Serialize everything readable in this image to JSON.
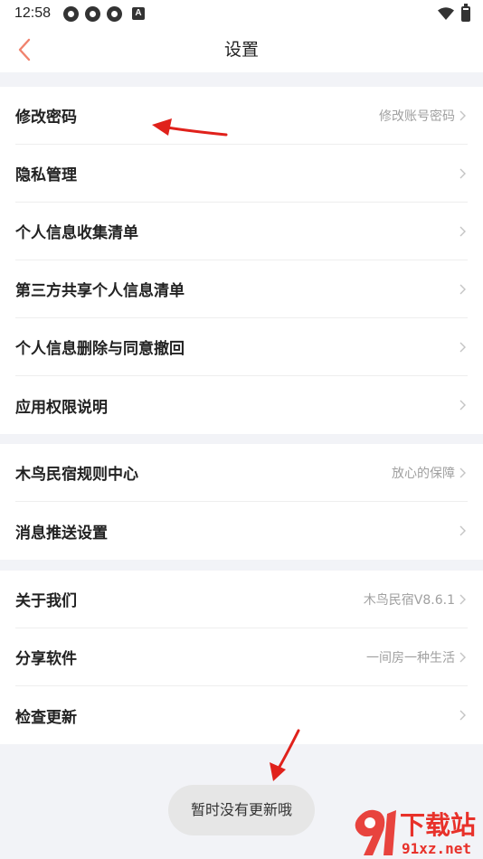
{
  "status_bar": {
    "time": "12:58",
    "icons": [
      "gear-icon",
      "gear-icon",
      "gear-icon",
      "a-badge-icon"
    ],
    "badge_letter": "A"
  },
  "nav": {
    "title": "设置",
    "back_icon": "chevron-left-icon",
    "accent_color": "#f0826d"
  },
  "groups": [
    {
      "items": [
        {
          "label": "修改密码",
          "value": "修改账号密码"
        },
        {
          "label": "隐私管理",
          "value": ""
        },
        {
          "label": "个人信息收集清单",
          "value": ""
        },
        {
          "label": "第三方共享个人信息清单",
          "value": ""
        },
        {
          "label": "个人信息删除与同意撤回",
          "value": ""
        },
        {
          "label": "应用权限说明",
          "value": ""
        }
      ]
    },
    {
      "items": [
        {
          "label": "木鸟民宿规则中心",
          "value": "放心的保障"
        },
        {
          "label": "消息推送设置",
          "value": ""
        }
      ]
    },
    {
      "items": [
        {
          "label": "关于我们",
          "value": "木鸟民宿V8.6.1"
        },
        {
          "label": "分享软件",
          "value": "一间房一种生活"
        },
        {
          "label": "检查更新",
          "value": ""
        }
      ]
    }
  ],
  "toast": {
    "message": "暂时没有更新哦"
  },
  "watermark": {
    "brand_text": "下载站",
    "url_text": "91xz.net",
    "color": "#e8312a"
  },
  "annotation_color": "#e0211b"
}
